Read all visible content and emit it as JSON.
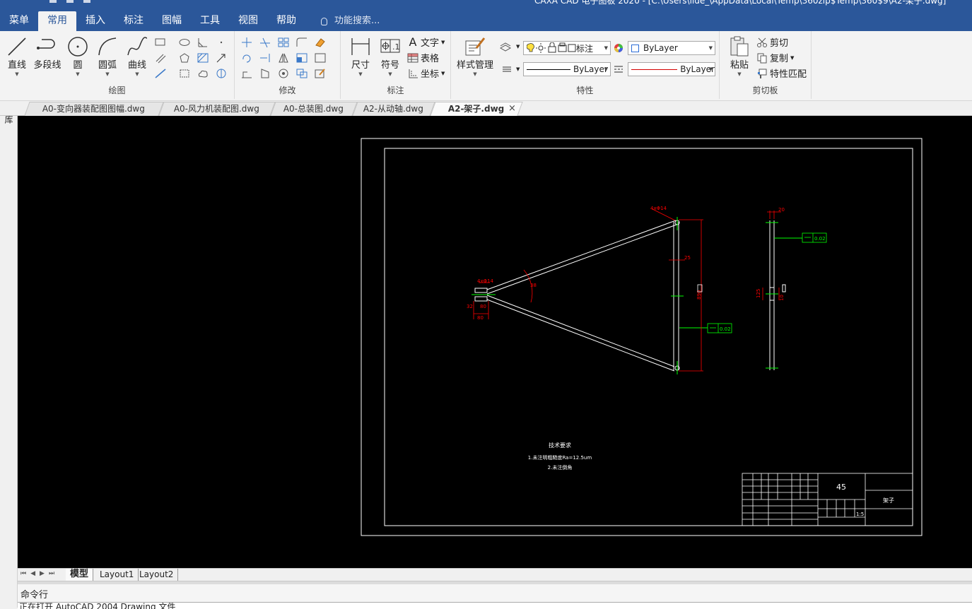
{
  "app": {
    "title": "CAXA CAD 电子图板 2020 - [C:\\Users\\lide_\\AppData\\Local\\Temp\\360zip$Temp\\360$9\\A2-架子.dwg]"
  },
  "menus": {
    "items": [
      "菜单",
      "常用",
      "插入",
      "标注",
      "图幅",
      "工具",
      "视图",
      "帮助"
    ],
    "active": "常用",
    "search_placeholder": "功能搜索..."
  },
  "ribbon": {
    "draw": {
      "title": "绘图",
      "buttons": [
        "直线",
        "多段线",
        "圆",
        "圆弧",
        "曲线"
      ]
    },
    "modify": {
      "title": "修改"
    },
    "annotate": {
      "title": "标注",
      "dimension": "尺寸",
      "symbol": "符号",
      "text": "文字",
      "table": "表格",
      "coordinate": "坐标"
    },
    "properties": {
      "title": "特性",
      "style_manager": "样式管理",
      "layer_name": "标注",
      "color_combo": "ByLayer",
      "linetype_combo": "ByLayer",
      "lineweight_combo": "ByLayer",
      "line_color": "#d40000"
    },
    "clipboard": {
      "title": "剪切板",
      "paste": "粘贴",
      "cut": "剪切",
      "copy": "复制",
      "match": "特性匹配"
    }
  },
  "doc_tabs": [
    {
      "label": "A0-变向器装配图图幅.dwg",
      "active": false
    },
    {
      "label": "A0-风力机装配图.dwg",
      "active": false
    },
    {
      "label": "A0-总装图.dwg",
      "active": false
    },
    {
      "label": "A2-从动轴.dwg",
      "active": false
    },
    {
      "label": "A2-架子.dwg",
      "active": true
    }
  ],
  "tab_close": "×",
  "side_panel": {
    "label": "图库"
  },
  "drawing": {
    "tech_req_title": "技术要求",
    "tech_req_1": "1.未注明粗糙度Ra=12.5um",
    "tech_req_2": "2.未注倒角",
    "material": "45",
    "part_name": "架子",
    "scale": "1:5",
    "dims": {
      "hole_left": "4xΦ14",
      "hole_top": "4xΦ14",
      "angle": "38",
      "dim_32": "32",
      "dim_80_left": "80",
      "dim_80_bottom": "80",
      "dim_25": "25",
      "dim_890": "890",
      "dim_20": "20",
      "dim_125": "125",
      "dim_10": "10",
      "flatness_a": "0.02",
      "flatness_b": "0.02"
    },
    "colors": {
      "outline": "#ffffff",
      "dimension": "#ff0000",
      "centerline": "#00ff00"
    }
  },
  "layout_tabs": [
    "模型",
    "Layout1",
    "Layout2"
  ],
  "layout_active": "模型",
  "command": {
    "label": "命令行",
    "history": "正在打开 AutoCAD 2004 Drawing 文件"
  }
}
